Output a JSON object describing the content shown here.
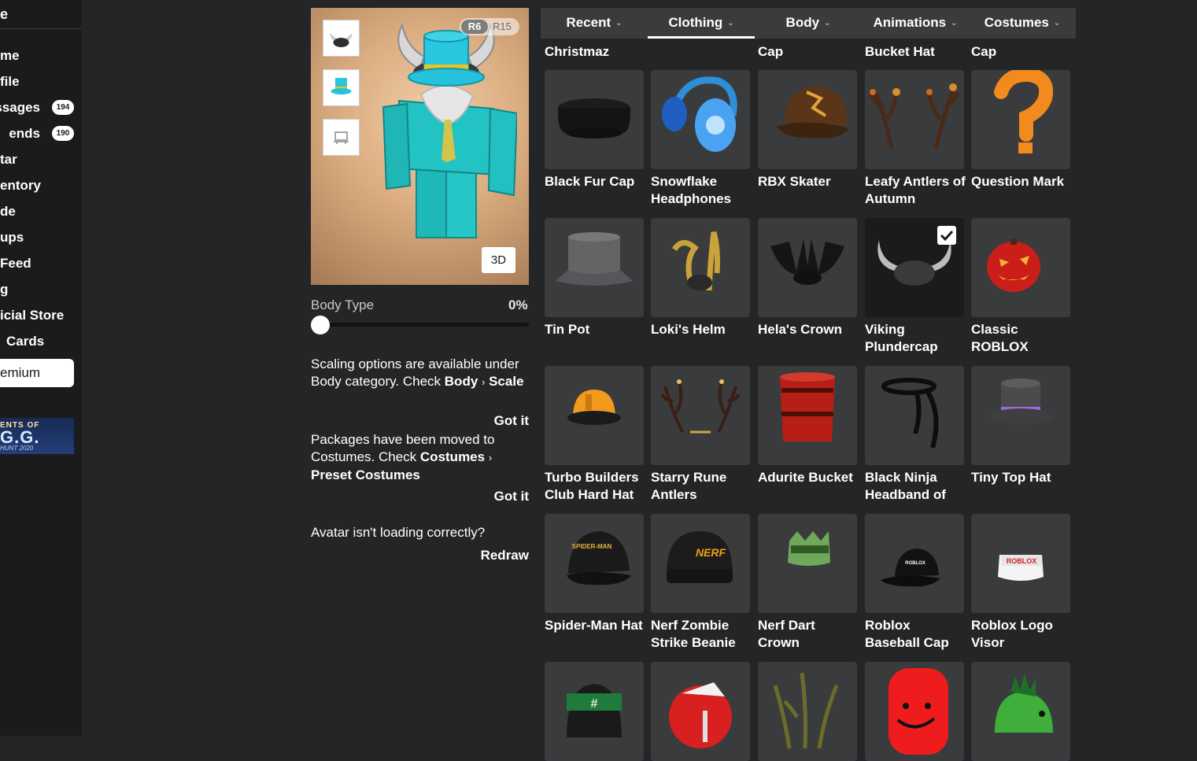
{
  "sidebar": {
    "header": "e",
    "items": [
      {
        "label": "me"
      },
      {
        "label": "file"
      },
      {
        "label": "ssages",
        "badge": "194"
      },
      {
        "label": "ends",
        "badge": "190"
      },
      {
        "label": "tar"
      },
      {
        "label": "entory"
      },
      {
        "label": "de"
      },
      {
        "label": "ups"
      },
      {
        "label": "Feed"
      },
      {
        "label": "g"
      },
      {
        "label": "icial Store"
      },
      {
        "label": "Cards"
      }
    ],
    "premium_label": "emium",
    "sponsor": {
      "line1": "ENTS OF",
      "line2": "G.G.",
      "line3": "HUNT 2020"
    }
  },
  "preview": {
    "rig_r6": "R6",
    "rig_r15": "R15",
    "button_3d": "3D"
  },
  "body_type": {
    "label": "Body Type",
    "value": "0%",
    "fraction": 0
  },
  "notes": [
    {
      "text": "Scaling options are available under Body category. Check",
      "link1": "Body",
      "sep": "›",
      "link2": "Scale",
      "action": "Got it"
    },
    {
      "text": "Packages have been moved to Costumes. Check",
      "link1": "Costumes",
      "sep": "›",
      "link2": "Preset Costumes",
      "action": "Got it"
    }
  ],
  "redraw": {
    "question": "Avatar isn't loading correctly?",
    "action": "Redraw"
  },
  "tabs": [
    {
      "label": "Recent",
      "active": false
    },
    {
      "label": "Clothing",
      "active": true
    },
    {
      "label": "Body",
      "active": false
    },
    {
      "label": "Animations",
      "active": false
    },
    {
      "label": "Costumes",
      "active": false
    }
  ],
  "top_row_names": [
    "Christmaz",
    "",
    "Cap",
    "Bucket Hat",
    "Cap"
  ],
  "items": [
    {
      "name": "Black Fur Cap",
      "icon": "fur-cap-icon"
    },
    {
      "name": "Snowflake Headphones",
      "icon": "headphones-icon"
    },
    {
      "name": "RBX Skater",
      "icon": "skater-cap-icon"
    },
    {
      "name": "Leafy Antlers of Autumn",
      "icon": "antlers-icon"
    },
    {
      "name": "Question Mark",
      "icon": "question-mark-icon"
    },
    {
      "name": "Tin Pot",
      "icon": "tin-pot-icon"
    },
    {
      "name": "Loki's Helm",
      "icon": "loki-helm-icon"
    },
    {
      "name": "Hela's Crown",
      "icon": "hela-crown-icon"
    },
    {
      "name": "Viking Plundercap",
      "icon": "viking-helmet-icon",
      "selected": true
    },
    {
      "name": "Classic ROBLOX",
      "icon": "pumpkin-icon"
    },
    {
      "name": "Turbo Builders Club Hard Hat",
      "icon": "hard-hat-icon"
    },
    {
      "name": "Starry Rune Antlers",
      "icon": "rune-antlers-icon"
    },
    {
      "name": "Adurite Bucket",
      "icon": "bucket-icon"
    },
    {
      "name": "Black Ninja Headband of",
      "icon": "headband-icon"
    },
    {
      "name": "Tiny Top Hat",
      "icon": "top-hat-icon"
    },
    {
      "name": "Spider-Man Hat",
      "icon": "baseball-cap-icon"
    },
    {
      "name": "Nerf Zombie Strike Beanie",
      "icon": "beanie-icon"
    },
    {
      "name": "Nerf Dart Crown",
      "icon": "crown-icon"
    },
    {
      "name": "Roblox Baseball Cap",
      "icon": "baseball-cap-icon"
    },
    {
      "name": "Roblox Logo Visor",
      "icon": "visor-icon"
    },
    {
      "name": "",
      "icon": "hat-icon"
    },
    {
      "name": "",
      "icon": "football-helmet-icon"
    },
    {
      "name": "",
      "icon": "branches-icon"
    },
    {
      "name": "",
      "icon": "red-head-icon"
    },
    {
      "name": "",
      "icon": "dino-hat-icon"
    }
  ],
  "item_labels": {
    "spiderman_logo": "SPIDER-MAN",
    "nerf_logo": "NERF",
    "roblox_logo": "ROBLOX"
  }
}
